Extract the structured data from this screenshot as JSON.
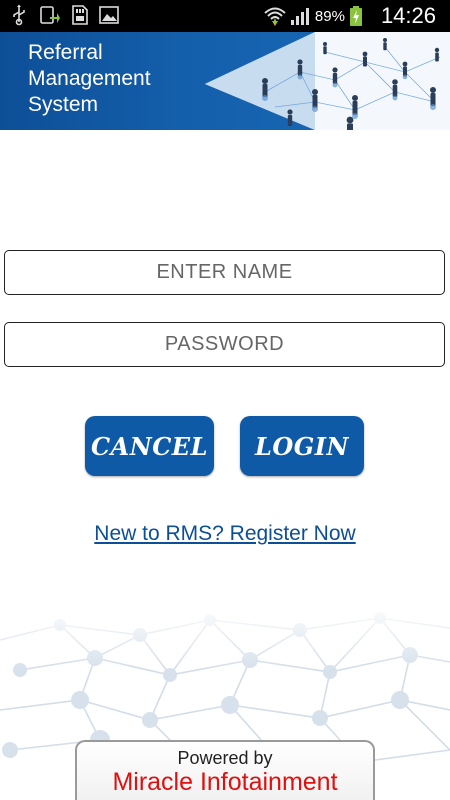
{
  "status_bar": {
    "battery": "89%",
    "time": "14:26",
    "icons": [
      "usb-icon",
      "download-icon",
      "sd-card-icon",
      "image-icon",
      "wifi-icon",
      "signal-icon",
      "battery-icon"
    ]
  },
  "banner": {
    "title_line1": "Referral",
    "title_line2": "Management",
    "title_line3": "System"
  },
  "form": {
    "name_placeholder": "ENTER NAME",
    "password_placeholder": "PASSWORD",
    "cancel_label": "CANCEL",
    "login_label": "LOGIN",
    "register_link": "New to RMS? Register Now"
  },
  "footer": {
    "powered_by": "Powered by",
    "company": "Miracle Infotainment"
  },
  "colors": {
    "brand_blue": "#0e5aa6",
    "link_blue": "#0d4f97",
    "company_red": "#e01010"
  }
}
